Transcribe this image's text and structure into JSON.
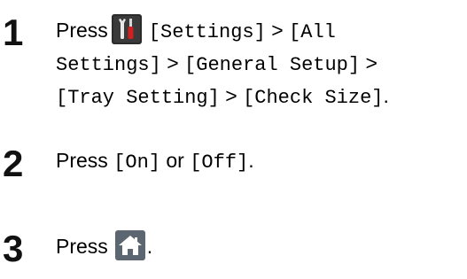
{
  "steps": [
    {
      "number": "1",
      "press": "Press",
      "icon": "settings-icon",
      "line1_tail_mono_a": "[Settings]",
      "gt1": " > ",
      "line1_tail_mono_b": "[All",
      "line2_mono_a": "Settings]",
      "gt2": " > ",
      "line2_mono_b": "[General Setup]",
      "gt3": " >",
      "line3_mono_a": "[Tray Setting]",
      "gt4": " > ",
      "line3_mono_b": "[Check Size]",
      "period": "."
    },
    {
      "number": "2",
      "press": "Press ",
      "mono_a": "[On]",
      "or": " or ",
      "mono_b": "[Off]",
      "period": "."
    },
    {
      "number": "3",
      "press": "Press",
      "icon": "home-icon",
      "period": "."
    }
  ],
  "colors": {
    "settings_icon_bg": "#2b2b2b",
    "home_icon_bg": "#5b6670",
    "step_number": "#111111"
  }
}
